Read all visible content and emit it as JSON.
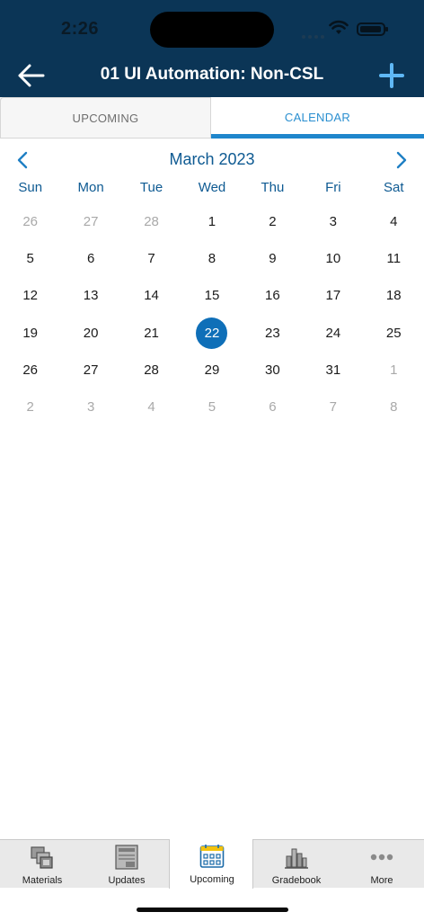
{
  "status_bar": {
    "time": "2:26"
  },
  "header": {
    "title": "01 UI Automation: Non-CSL"
  },
  "tabs": [
    {
      "label": "UPCOMING",
      "active": false
    },
    {
      "label": "CALENDAR",
      "active": true
    }
  ],
  "calendar": {
    "month_label": "March 2023",
    "weekdays": [
      "Sun",
      "Mon",
      "Tue",
      "Wed",
      "Thu",
      "Fri",
      "Sat"
    ],
    "weeks": [
      [
        "26",
        "27",
        "28",
        "1",
        "2",
        "3",
        "4"
      ],
      [
        "5",
        "6",
        "7",
        "8",
        "9",
        "10",
        "11"
      ],
      [
        "12",
        "13",
        "14",
        "15",
        "16",
        "17",
        "18"
      ],
      [
        "19",
        "20",
        "21",
        "22",
        "23",
        "24",
        "25"
      ],
      [
        "26",
        "27",
        "28",
        "29",
        "30",
        "31",
        "1"
      ],
      [
        "2",
        "3",
        "4",
        "5",
        "6",
        "7",
        "8"
      ]
    ],
    "selected_day": "22",
    "colors": {
      "accent": "#0f6fb8",
      "header_text": "#0e5a92",
      "muted": "#a9a9a9"
    }
  },
  "tabbar": {
    "items": [
      {
        "label": "Materials",
        "icon": "materials-icon"
      },
      {
        "label": "Updates",
        "icon": "updates-icon"
      },
      {
        "label": "Upcoming",
        "icon": "calendar-icon",
        "active": true
      },
      {
        "label": "Gradebook",
        "icon": "gradebook-icon"
      },
      {
        "label": "More",
        "icon": "more-icon"
      }
    ]
  },
  "colors": {
    "header_bg": "#0b3556",
    "tab_accent": "#1f86cc",
    "add_button": "#5fb8f5"
  }
}
